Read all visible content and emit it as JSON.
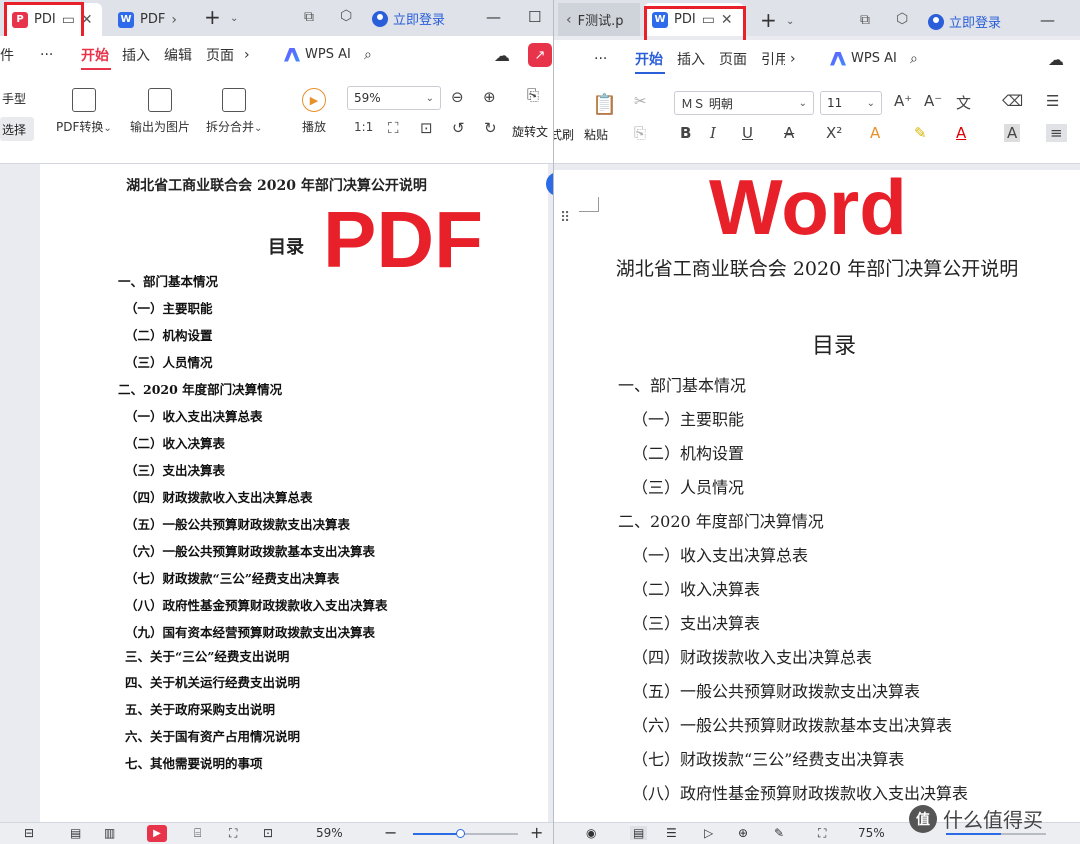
{
  "pdf": {
    "tabs": {
      "active_label": "PDI",
      "other_label": "PDF"
    },
    "header": {
      "login": "立即登录"
    },
    "menu": {
      "file_partial": "件",
      "more": "···",
      "items": [
        "开始",
        "插入",
        "编辑",
        "页面"
      ],
      "wps_ai": "WPS AI"
    },
    "ribbon": {
      "hand": "手型",
      "select": "选择",
      "pdf_convert": "PDF转换",
      "export_image": "输出为图片",
      "split_merge": "拆分合并",
      "play": "播放",
      "zoom": "59%",
      "rotate": "旋转文"
    },
    "document": {
      "title": "湖北省工商业联合会 2020 年部门决算公开说明",
      "toc_title": "目录",
      "items": [
        "一、部门基本情况",
        "（一）主要职能",
        "（二）机构设置",
        "（三）人员情况",
        "二、2020 年度部门决算情况",
        "（一）收入支出决算总表",
        "（二）收入决算表",
        "（三）支出决算表",
        "（四）财政拨款收入支出决算总表",
        "（五）一般公共预算财政拨款支出决算表",
        "（六）一般公共预算财政拨款基本支出决算表",
        "（七）财政拨款“三公”经费支出决算表",
        "（八）政府性基金预算财政拨款收入支出决算表",
        "（九）国有资本经营预算财政拨款支出决算表",
        "三、关于“三公”经费支出说明",
        "四、关于机关运行经费支出说明",
        "五、关于政府采购支出说明",
        "六、关于国有资产占用情况说明",
        "七、其他需要说明的事项"
      ]
    },
    "overlay_label": "PDF",
    "status": {
      "zoom": "59%",
      "zoom_level": 0.45
    }
  },
  "word": {
    "tabs": {
      "prev_label": "F测试.p",
      "active_label": "PDI"
    },
    "header": {
      "login": "立即登录"
    },
    "menu": {
      "more": "···",
      "items": [
        "开始",
        "插入",
        "页面",
        "引用"
      ],
      "wps_ai": "WPS AI"
    },
    "ribbon": {
      "format_brush_partial": "式刷",
      "paste": "粘贴",
      "font": "ＭＳ 明朝",
      "size": "11"
    },
    "document": {
      "title": "湖北省工商业联合会 2020 年部门决算公开说明",
      "toc_title": "目录",
      "items": [
        "一、部门基本情况",
        "（一）主要职能",
        "（二）机构设置",
        "（三）人员情况",
        "二、2020 年度部门决算情况",
        "（一）收入支出决算总表",
        "（二）收入决算表",
        "（三）支出决算表",
        "（四）财政拨款收入支出决算总表",
        "（五）一般公共预算财政拨款支出决算表",
        "（六）一般公共预算财政拨款基本支出决算表",
        "（七）财政拨款“三公”经费支出决算表",
        "（八）政府性基金预算财政拨款收入支出决算表"
      ]
    },
    "overlay_label": "Word",
    "status": {
      "zoom": "75%",
      "zoom_level": 0.55
    },
    "watermark": "值 什么值得买"
  },
  "colors": {
    "accent_red": "#e8344a",
    "accent_blue": "#2b5fd9",
    "annotation_red": "#e8202a"
  }
}
